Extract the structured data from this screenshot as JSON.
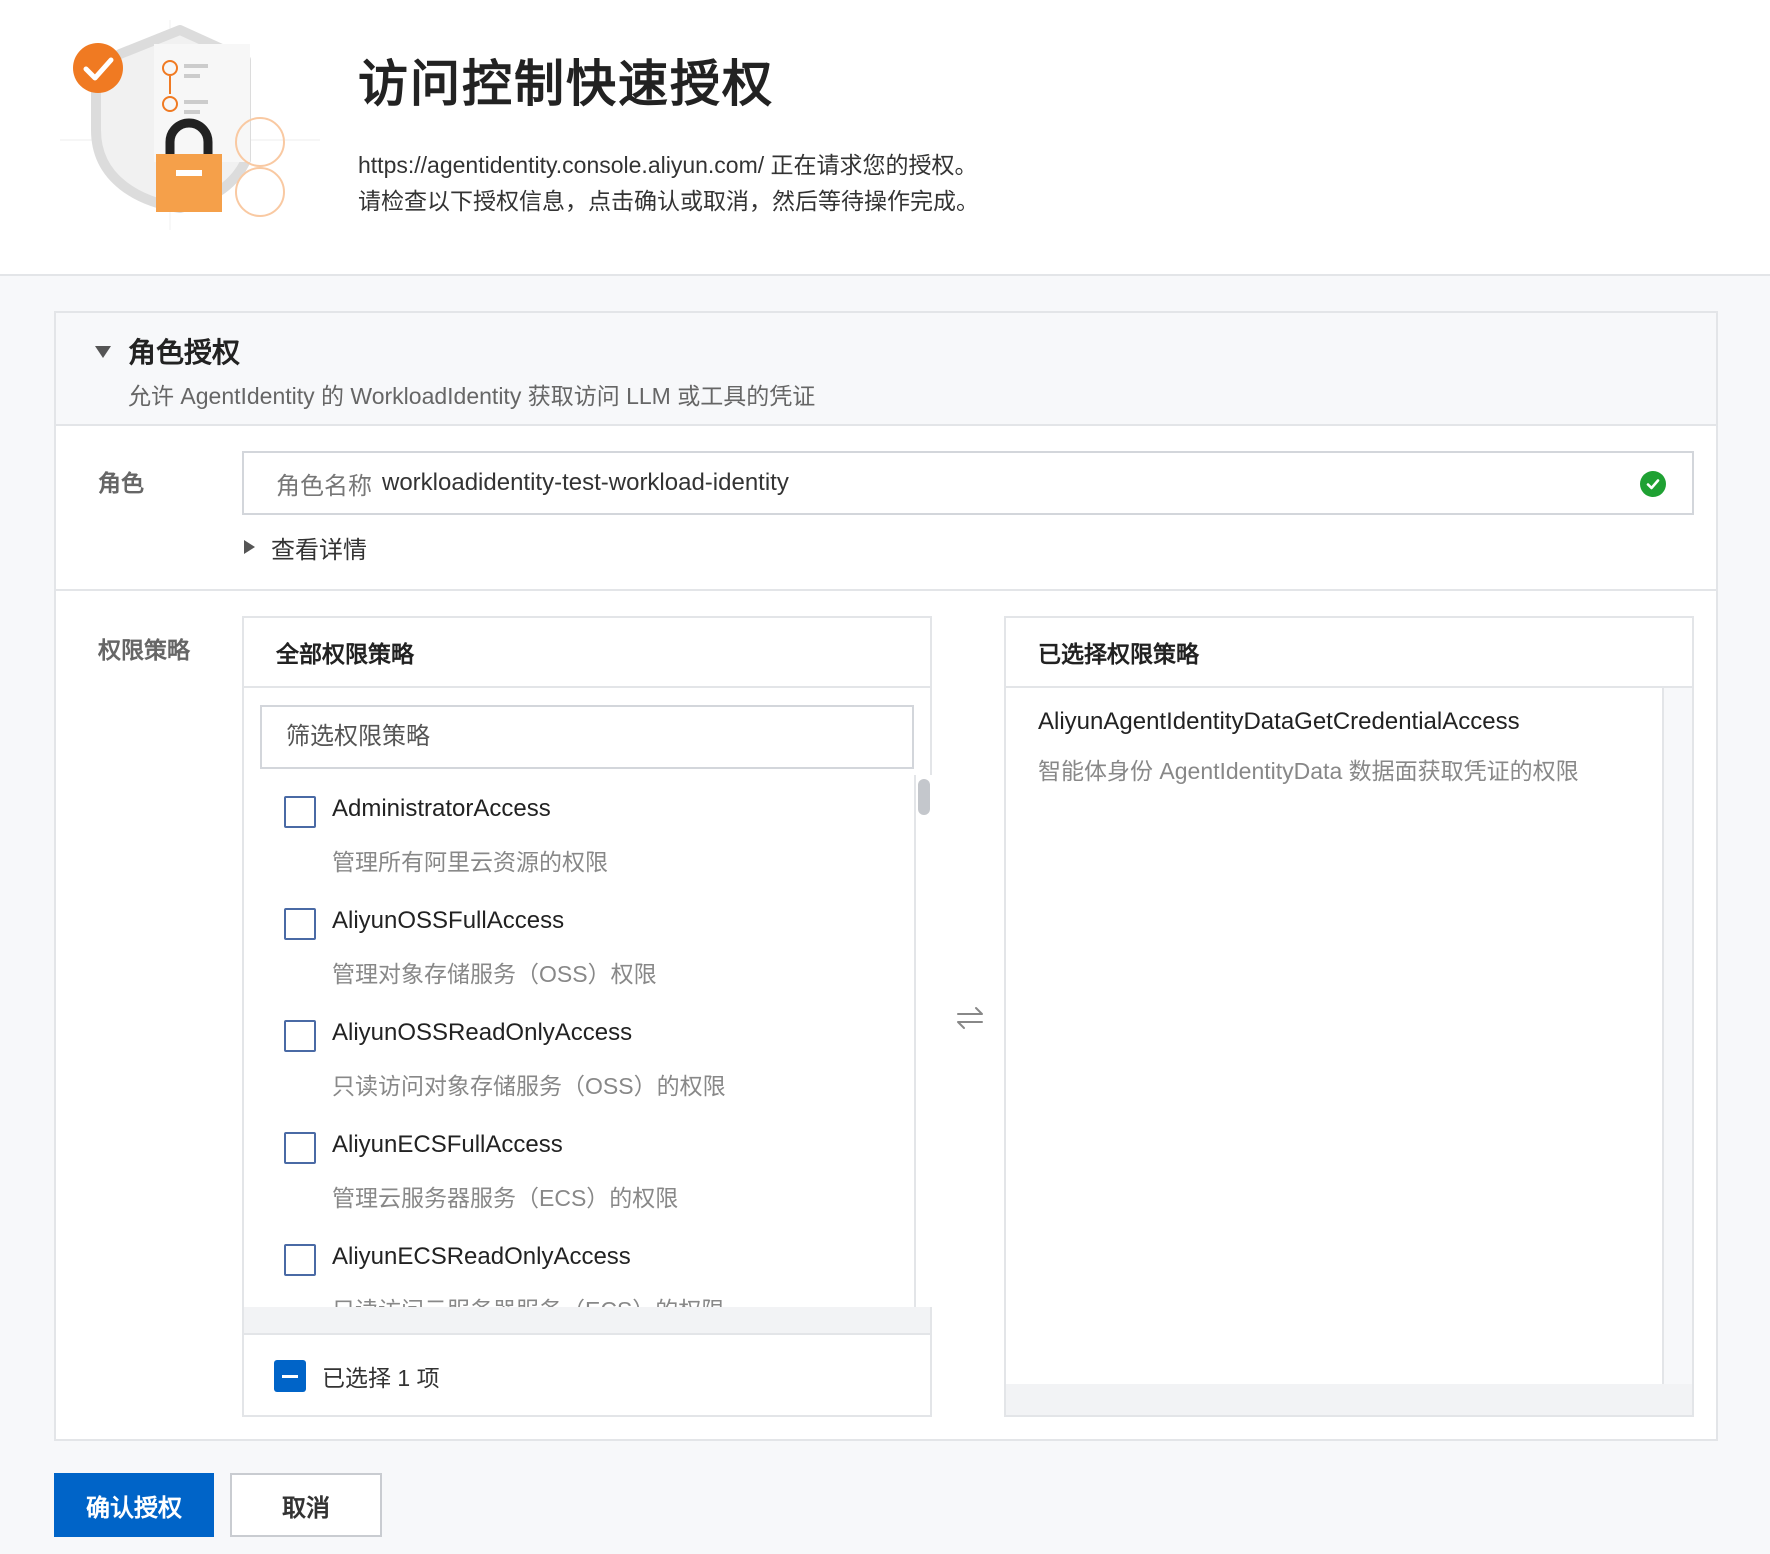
{
  "header": {
    "title": "访问控制快速授权",
    "request_line": "https://agentidentity.console.aliyun.com/ 正在请求您的授权。",
    "instruction_line": "请检查以下授权信息，点击确认或取消，然后等待操作完成。",
    "illustration_icon": "shield-lock-illustration"
  },
  "section": {
    "title": "角色授权",
    "subtitle": "允许 AgentIdentity 的 WorkloadIdentity 获取访问 LLM 或工具的凭证",
    "expanded": true
  },
  "role": {
    "label": "角色",
    "prefix": "角色名称",
    "value": "workloadidentity-test-workload-identity",
    "status_icon": "check-circle-icon",
    "details_label": "查看详情"
  },
  "policy": {
    "label": "权限策略",
    "all_panel": {
      "title": "全部权限策略",
      "filter_placeholder": "筛选权限策略",
      "items": [
        {
          "name": "AdministratorAccess",
          "desc": "管理所有阿里云资源的权限",
          "checked": false
        },
        {
          "name": "AliyunOSSFullAccess",
          "desc": "管理对象存储服务（OSS）权限",
          "checked": false
        },
        {
          "name": "AliyunOSSReadOnlyAccess",
          "desc": "只读访问对象存储服务（OSS）的权限",
          "checked": false
        },
        {
          "name": "AliyunECSFullAccess",
          "desc": "管理云服务器服务（ECS）的权限",
          "checked": false
        },
        {
          "name": "AliyunECSReadOnlyAccess",
          "desc": "只读访问云服务器服务（ECS）的权限",
          "checked": false
        }
      ],
      "footer_label": "已选择 1 项"
    },
    "selected_panel": {
      "title": "已选择权限策略",
      "items": [
        {
          "name": "AliyunAgentIdentityDataGetCredentialAccess",
          "desc": "智能体身份 AgentIdentityData 数据面获取凭证的权限"
        }
      ]
    }
  },
  "actions": {
    "confirm_label": "确认授权",
    "cancel_label": "取消"
  },
  "colors": {
    "primary": "#0064c8",
    "success": "#1fa133",
    "brand_orange": "#f07a22"
  }
}
